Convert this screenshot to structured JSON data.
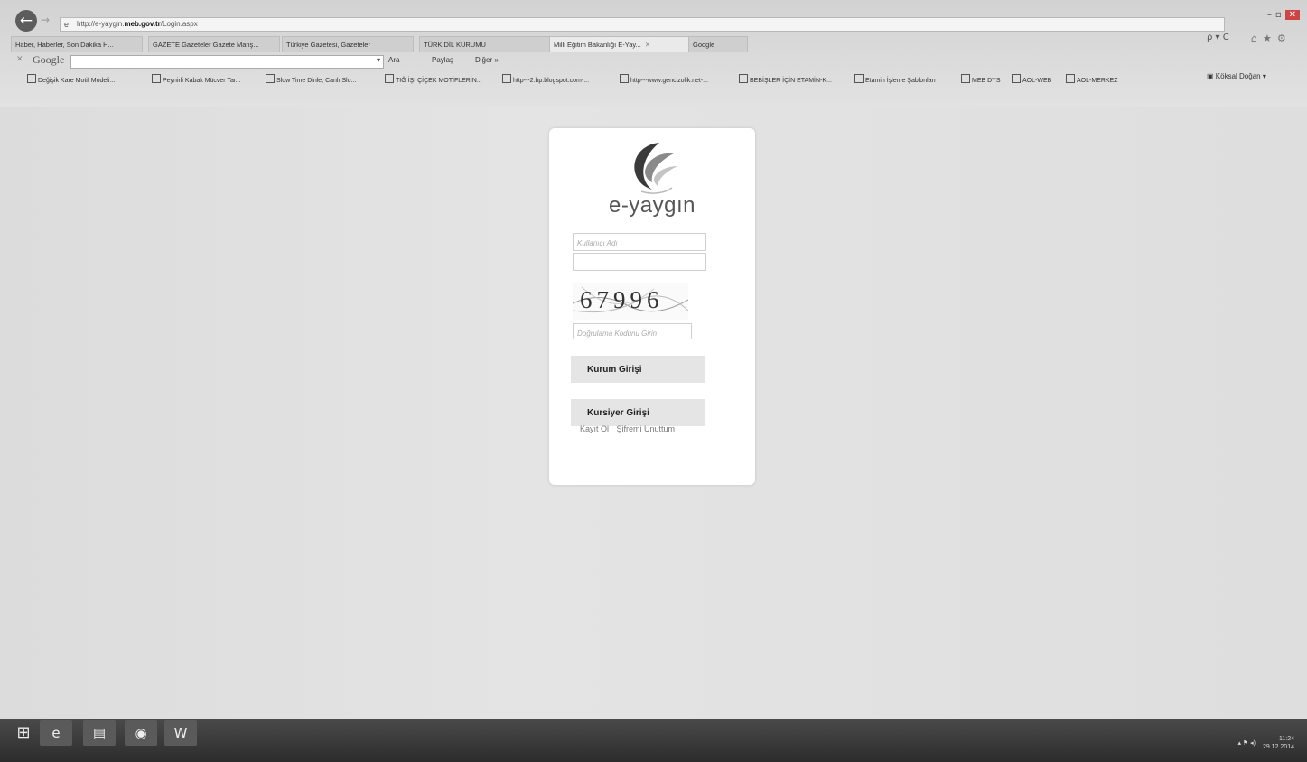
{
  "browser": {
    "address": {
      "prefix": "http://e-yaygin.",
      "domain": "meb.gov.tr",
      "path": "/Login.aspx"
    },
    "tabs": [
      {
        "label": "Haber, Haberler, Son Dakika H..."
      },
      {
        "label": "GAZETE Gazeteler Gazete Manş..."
      },
      {
        "label": "Türkiye Gazetesi, Gazeteler"
      },
      {
        "label": "TÜRK DİL KURUMU"
      },
      {
        "label": "Milli Eğitim Bakanlığı E-Yay...",
        "active": true
      },
      {
        "label": "Google"
      }
    ],
    "address_tools": "ρ ▾ C",
    "google_bar": {
      "brand": "Google",
      "search_label": "Ara",
      "share_label": "Paylaş",
      "more_label": "Diğer »"
    },
    "bookmarks": [
      "Değişik Kare Motif Modeli...",
      "Peynirli Kabak Mücver Tar...",
      "Slow Time Dinle, Canlı Slo...",
      "TIĞ İŞİ ÇİÇEK MOTİFLERİN...",
      "http---2.bp.blogspot.com-...",
      "http---www.gencizolik.net-...",
      "BEBİŞLER İÇİN ETAMİN-K...",
      "Etamin İşleme Şablonları",
      "MEB DYS",
      "AOL-WEB",
      "AOL-MERKEZ"
    ],
    "user": "Köksal Doğan ▾"
  },
  "login": {
    "brand": "e-yaygın",
    "username_placeholder": "Kullanıcı Adı",
    "password_placeholder": "",
    "captcha_value": "67996",
    "captcha_placeholder": "Doğrulama Kodunu Girin",
    "institution_login": "Kurum Girişi",
    "trainee_login": "Kursiyer Girişi",
    "register_link": "Kayıt Ol",
    "forgot_link": "Şifremi Unuttum"
  },
  "taskbar": {
    "time": "11:24",
    "date": "29.12.2014"
  },
  "colors": {
    "logo_dark": "#3a3a3a",
    "logo_gray": "#8a8a8a",
    "logo_light": "#c4c4c4",
    "button_bg": "#e5e5e5"
  }
}
